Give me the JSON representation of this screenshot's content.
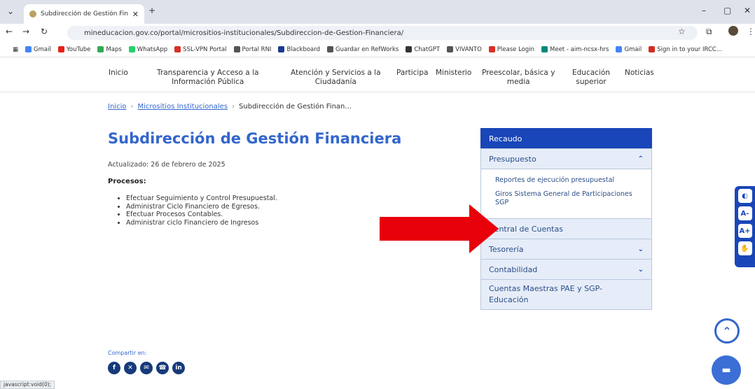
{
  "browser": {
    "tab_title": "Subdirección de Gestión Financ",
    "url": "mineducacion.gov.co/portal/micrositios-institucionales/Subdireccion-de-Gestion-Financiera/",
    "bookmarks": [
      "Gmail",
      "YouTube",
      "Maps",
      "WhatsApp",
      "SSL-VPN Portal",
      "Portal RNI",
      "Blackboard",
      "Guardar en RefWorks",
      "ChatGPT",
      "VIVANTO",
      "Please Login",
      "Meet - aim-ncsx-hrs",
      "Gmail",
      "Sign in to your IRCC..."
    ],
    "status": "javascript:void(0);"
  },
  "nav": [
    {
      "l1": "Inicio",
      "l2": ""
    },
    {
      "l1": "Transparencia y Acceso a la",
      "l2": "Información Pública"
    },
    {
      "l1": "Atención y Servicios a la",
      "l2": "Ciudadanía"
    },
    {
      "l1": "Participa",
      "l2": ""
    },
    {
      "l1": "Ministerio",
      "l2": ""
    },
    {
      "l1": "Preescolar, básica y",
      "l2": "media"
    },
    {
      "l1": "Educación",
      "l2": "superior"
    },
    {
      "l1": "Noticias",
      "l2": ""
    }
  ],
  "breadcrumb": {
    "home": "Inicio",
    "parent": "Micrositios Institucionales",
    "current": "Subdirección de Gestión Finan..."
  },
  "page": {
    "title": "Subdirección de Gestión Financiera",
    "updated": "Actualizado: 26 de febrero de 2025",
    "processes_title": "Procesos:",
    "processes": [
      "Efectuar Seguimiento y Control Presupuestal.",
      "Administrar Ciclo Financiero de Egresos.",
      "Efectuar Procesos Contables.",
      "Administrar ciclo Financiero de Ingresos"
    ]
  },
  "sidemenu": {
    "recaudo": "Recaudo",
    "presupuesto": "Presupuesto",
    "presupuesto_sub": [
      "Reportes de ejecución presupuestal",
      "Giros Sistema General de Participaciones SGP"
    ],
    "central": "Central de Cuentas",
    "tesoreria": "Tesorería",
    "contabilidad": "Contabilidad",
    "cuentas_1": "Cuentas Maestras PAE y SGP-",
    "cuentas_2": "Educación"
  },
  "share": {
    "label": "Compartir en:",
    "icons": [
      "facebook-icon",
      "x-icon",
      "email-icon",
      "whatsapp-icon",
      "linkedin-icon"
    ]
  },
  "colors": {
    "accent": "#3366cc",
    "active": "#1946b8",
    "arrow": "#e8000a"
  }
}
